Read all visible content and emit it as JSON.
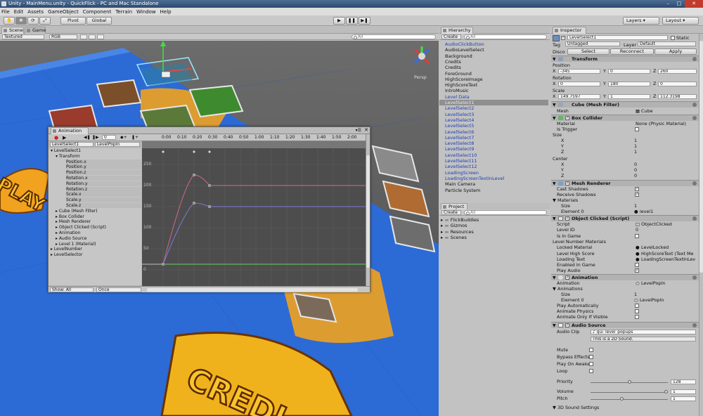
{
  "window": {
    "title": "Unity - MainMenu.unity - QuickFlick - PC and Mac Standalone"
  },
  "menu": [
    "File",
    "Edit",
    "Assets",
    "GameObject",
    "Component",
    "Terrain",
    "Window",
    "Help"
  ],
  "toolbar": {
    "pivot": "Pivot",
    "global": "Global",
    "layers": "Layers",
    "layout": "Layout"
  },
  "scene": {
    "tab_scene": "Scene",
    "tab_game": "Game",
    "render_mode": "Textured",
    "color_mode": "RGB",
    "search_placeholder": "All",
    "persp_label": "Persp"
  },
  "hierarchy": {
    "tab": "Hierarchy",
    "create": "Create",
    "search_placeholder": "All",
    "items": [
      {
        "label": "AudioClickButton",
        "blue": true
      },
      {
        "label": "AudioLevelSelect",
        "blue": false
      },
      {
        "label": "Background",
        "blue": false
      },
      {
        "label": "Credits",
        "blue": false
      },
      {
        "label": "Credits",
        "blue": false
      },
      {
        "label": "ForeGround",
        "blue": false
      },
      {
        "label": "HighScoreImage",
        "blue": false
      },
      {
        "label": "HighScoreText",
        "blue": false
      },
      {
        "label": "IntroMusic",
        "blue": false
      },
      {
        "label": "Level Data",
        "blue": true
      },
      {
        "label": "LevelSelect1",
        "blue": false,
        "selected": true
      },
      {
        "label": "LevelSelect2",
        "blue": true
      },
      {
        "label": "LevelSelect3",
        "blue": true
      },
      {
        "label": "LevelSelect4",
        "blue": true
      },
      {
        "label": "LevelSelect5",
        "blue": true
      },
      {
        "label": "LevelSelect6",
        "blue": true
      },
      {
        "label": "LevelSelect7",
        "blue": true
      },
      {
        "label": "LevelSelect8",
        "blue": true
      },
      {
        "label": "LevelSelect9",
        "blue": true
      },
      {
        "label": "LevelSelect10",
        "blue": true
      },
      {
        "label": "LevelSelect11",
        "blue": true
      },
      {
        "label": "LevelSelect12",
        "blue": true
      },
      {
        "label": "LoadingScreen",
        "blue": true
      },
      {
        "label": "LoadingScreenTextInLevel",
        "blue": true
      },
      {
        "label": "Main Camera",
        "blue": false
      },
      {
        "label": "Particle System",
        "blue": false
      }
    ]
  },
  "project": {
    "tab": "Project",
    "create": "Create",
    "search_placeholder": "All",
    "folders": [
      "FlickBuddies",
      "Gizmos",
      "Resources",
      "Scenes"
    ]
  },
  "inspector": {
    "tab": "Inspector",
    "object_name": "LevelSelect1",
    "static_label": "Static",
    "tag_label": "Tag",
    "tag_value": "Untagged",
    "layer_label": "Layer",
    "layer_value": "Default",
    "prefab_label": "Disco",
    "prefab_buttons": [
      "Select",
      "Reconnect",
      "Apply"
    ],
    "transform": {
      "title": "Transform",
      "position_label": "Position",
      "rotation_label": "Rotation",
      "scale_label": "Scale",
      "position": [
        "-345",
        "0",
        "260"
      ],
      "rotation": [
        "0",
        "180",
        "0"
      ],
      "scale": [
        "149.7597",
        "1",
        "112.3198"
      ]
    },
    "mesh_filter": {
      "title": "Cube (Mesh Filter)",
      "mesh_label": "Mesh",
      "mesh_value": "Cube"
    },
    "box_collider": {
      "title": "Box Collider",
      "material_label": "Material",
      "material_value": "None (Physic Material)",
      "is_trigger_label": "Is Trigger",
      "size_label": "Size",
      "size": {
        "x": "1",
        "y": "1",
        "z": "1"
      },
      "center_label": "Center",
      "center": {
        "x": "0",
        "y": "0",
        "z": "0"
      }
    },
    "mesh_renderer": {
      "title": "Mesh Renderer",
      "cast_shadows": "Cast Shadows",
      "receive_shadows": "Receive Shadows",
      "materials_label": "Materials",
      "size_label": "Size",
      "size_value": "1",
      "element0_label": "Element 0",
      "element0_value": "level1"
    },
    "object_clicked": {
      "title": "Object Clicked (Script)",
      "rows": [
        {
          "label": "Script",
          "value": "ObjectClicked",
          "kind": "field"
        },
        {
          "label": "Level ID",
          "value": "0",
          "kind": "text"
        },
        {
          "label": "Is In Game",
          "value": "",
          "kind": "check"
        },
        {
          "label": "Level Number Materials",
          "value": "",
          "kind": "fold"
        },
        {
          "label": "Locked Material",
          "value": "LevelLocked",
          "kind": "obj"
        },
        {
          "label": "Level High Score",
          "value": "HighScoreText (Text Me",
          "kind": "obj"
        },
        {
          "label": "Loading Text",
          "value": "LoadingScreenTextInLev",
          "kind": "obj"
        },
        {
          "label": "Enabled In Game",
          "value": "",
          "kind": "check"
        },
        {
          "label": "Play Audio",
          "value": "",
          "kind": "checked"
        }
      ]
    },
    "animation": {
      "title": "Animation",
      "animation_label": "Animation",
      "animation_value": "LevelPopIn",
      "animations_label": "Animations",
      "size_label": "Size",
      "size_value": "1",
      "element0_label": "Element 0",
      "element0_value": "LevelPopIn",
      "play_auto": "Play Automatically",
      "animate_physics": "Animate Physics",
      "animate_visible": "Animate Only If Visible"
    },
    "audio_source": {
      "title": "Audio Source",
      "clip_label": "Audio Clip",
      "clip_value": "gui_level_popups",
      "note": "This is a 2D Sound.",
      "mute": "Mute",
      "bypass": "Bypass Effects",
      "play_on_awake": "Play On Awake",
      "loop": "Loop",
      "priority_label": "Priority",
      "priority_value": "128",
      "priority_fraction": 0.5,
      "volume_label": "Volume",
      "volume_value": "1",
      "volume_fraction": 1.0,
      "pitch_label": "Pitch",
      "pitch_value": "1",
      "pitch_fraction": 0.4,
      "sound3d_label": "3D Sound Settings"
    }
  },
  "animation_window": {
    "tab": "Animation",
    "object_dd": "LevelSelect1",
    "clip_dd": "LevelPopIn",
    "frame_value": "0",
    "timeline": [
      "0:00",
      "0:10",
      "0:20",
      "0:30",
      "0:40",
      "0:50",
      "1:00",
      "1:10",
      "1:20",
      "1:30",
      "1:40",
      "1:50",
      "2:00"
    ],
    "yaxis": [
      "250",
      "200",
      "150",
      "100",
      "50",
      "0",
      "-50"
    ],
    "tree": [
      {
        "label": "LevelSelect1",
        "indent": 0,
        "kind": "root"
      },
      {
        "label": "Transform",
        "indent": 1,
        "kind": "comp"
      },
      {
        "label": "Position.x",
        "indent": 2,
        "kind": "prop"
      },
      {
        "label": "Position.y",
        "indent": 2,
        "kind": "prop"
      },
      {
        "label": "Position.z",
        "indent": 2,
        "kind": "prop"
      },
      {
        "label": "Rotation.x",
        "indent": 2,
        "kind": "prop"
      },
      {
        "label": "Rotation.y",
        "indent": 2,
        "kind": "prop"
      },
      {
        "label": "Rotation.z",
        "indent": 2,
        "kind": "prop"
      },
      {
        "label": "Scale.x",
        "indent": 2,
        "kind": "prop"
      },
      {
        "label": "Scale.y",
        "indent": 2,
        "kind": "prop"
      },
      {
        "label": "Scale.z",
        "indent": 2,
        "kind": "prop"
      },
      {
        "label": "Cube (Mesh Filter)",
        "indent": 1,
        "kind": "comp"
      },
      {
        "label": "Box Collider",
        "indent": 1,
        "kind": "comp"
      },
      {
        "label": "Mesh Renderer",
        "indent": 1,
        "kind": "comp"
      },
      {
        "label": "Object Clicked (Script)",
        "indent": 1,
        "kind": "comp"
      },
      {
        "label": "Animation",
        "indent": 1,
        "kind": "comp"
      },
      {
        "label": "Audio Source",
        "indent": 1,
        "kind": "comp"
      },
      {
        "label": "Level 1 (Material)",
        "indent": 1,
        "kind": "comp"
      },
      {
        "label": "LevelNumber",
        "indent": 0,
        "kind": "root"
      },
      {
        "label": "LevelSelector",
        "indent": 0,
        "kind": "root"
      }
    ],
    "show_label": "Show: All",
    "wrap_label": "Once"
  },
  "colors": {
    "accent_blue": "#1d3eb4",
    "selected_row": "#8f8f8f",
    "scene_bg": "#5b5b5b",
    "board_blue": "#2c6ad6"
  }
}
